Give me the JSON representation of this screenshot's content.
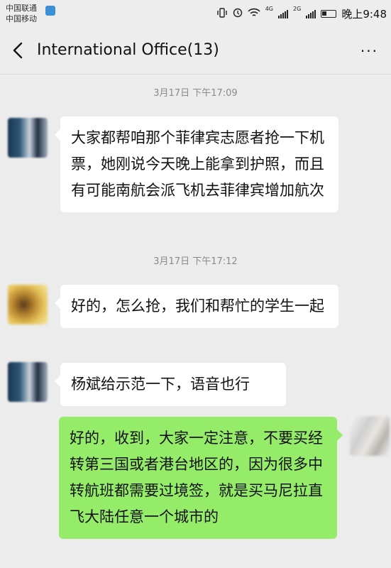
{
  "status_bar": {
    "carrier1": "中国联通",
    "carrier2": "中国移动",
    "net_label_1": "4G",
    "net_label_2": "2G",
    "time": "晚上9:48"
  },
  "header": {
    "title": "International Office(13)",
    "more_label": "···"
  },
  "timestamps": [
    "3月17日 下午17:09",
    "3月17日 下午17:12"
  ],
  "messages": [
    {
      "direction": "in",
      "text": "大家都帮咱那个菲律宾志愿者抢一下机票，她刚说今天晚上能拿到护照，而且有可能南航会派飞机去菲律宾增加航次"
    },
    {
      "direction": "in",
      "text": "好的，怎么抢，我们和帮忙的学生一起"
    },
    {
      "direction": "in",
      "text": "杨斌给示范一下，语音也行"
    },
    {
      "direction": "out",
      "text": "好的，收到，大家一定注意，不要买经转第三国或者港台地区的，因为很多中转航班都需要过境签，就是买马尼拉直飞大陆任意一个城市的"
    }
  ],
  "colors": {
    "background": "#ececec",
    "incoming_bubble": "#ffffff",
    "outgoing_bubble": "#95ec69",
    "timestamp_text": "#8a8a8a"
  }
}
